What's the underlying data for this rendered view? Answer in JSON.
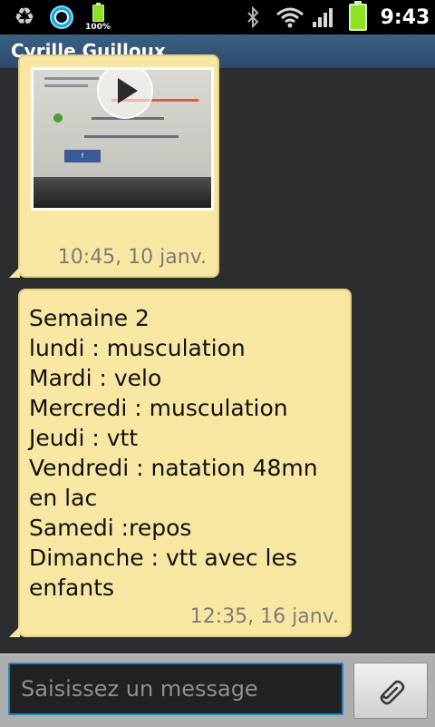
{
  "status_bar": {
    "battery_small_percent": "100%",
    "clock": "9:43"
  },
  "header": {
    "contact_name": "Cyrille Guilloux"
  },
  "messages": [
    {
      "type": "video",
      "timestamp": "10:45, 10 janv."
    },
    {
      "type": "text",
      "text": "Semaine 2\nlundi : musculation\nMardi : velo\nMercredi : musculation\nJeudi : vtt\nVendredi : natation 48mn\nen lac\nSamedi :repos\nDimanche : vtt avec les\nenfants",
      "timestamp": "12:35, 16 janv."
    }
  ],
  "composer": {
    "placeholder": "Saisissez un message"
  },
  "icons": {
    "recycle": "recycle-icon",
    "camera": "camera-icon",
    "bluetooth": "bluetooth-icon",
    "wifi": "wifi-icon",
    "signal": "signal-icon",
    "battery": "battery-icon",
    "play": "play-icon",
    "attach": "paperclip-icon"
  },
  "colors": {
    "bubble": "#f8e7a2",
    "title_bar": "#2b4b6c",
    "input_focus": "#1f86c7",
    "battery": "#8ee223"
  }
}
